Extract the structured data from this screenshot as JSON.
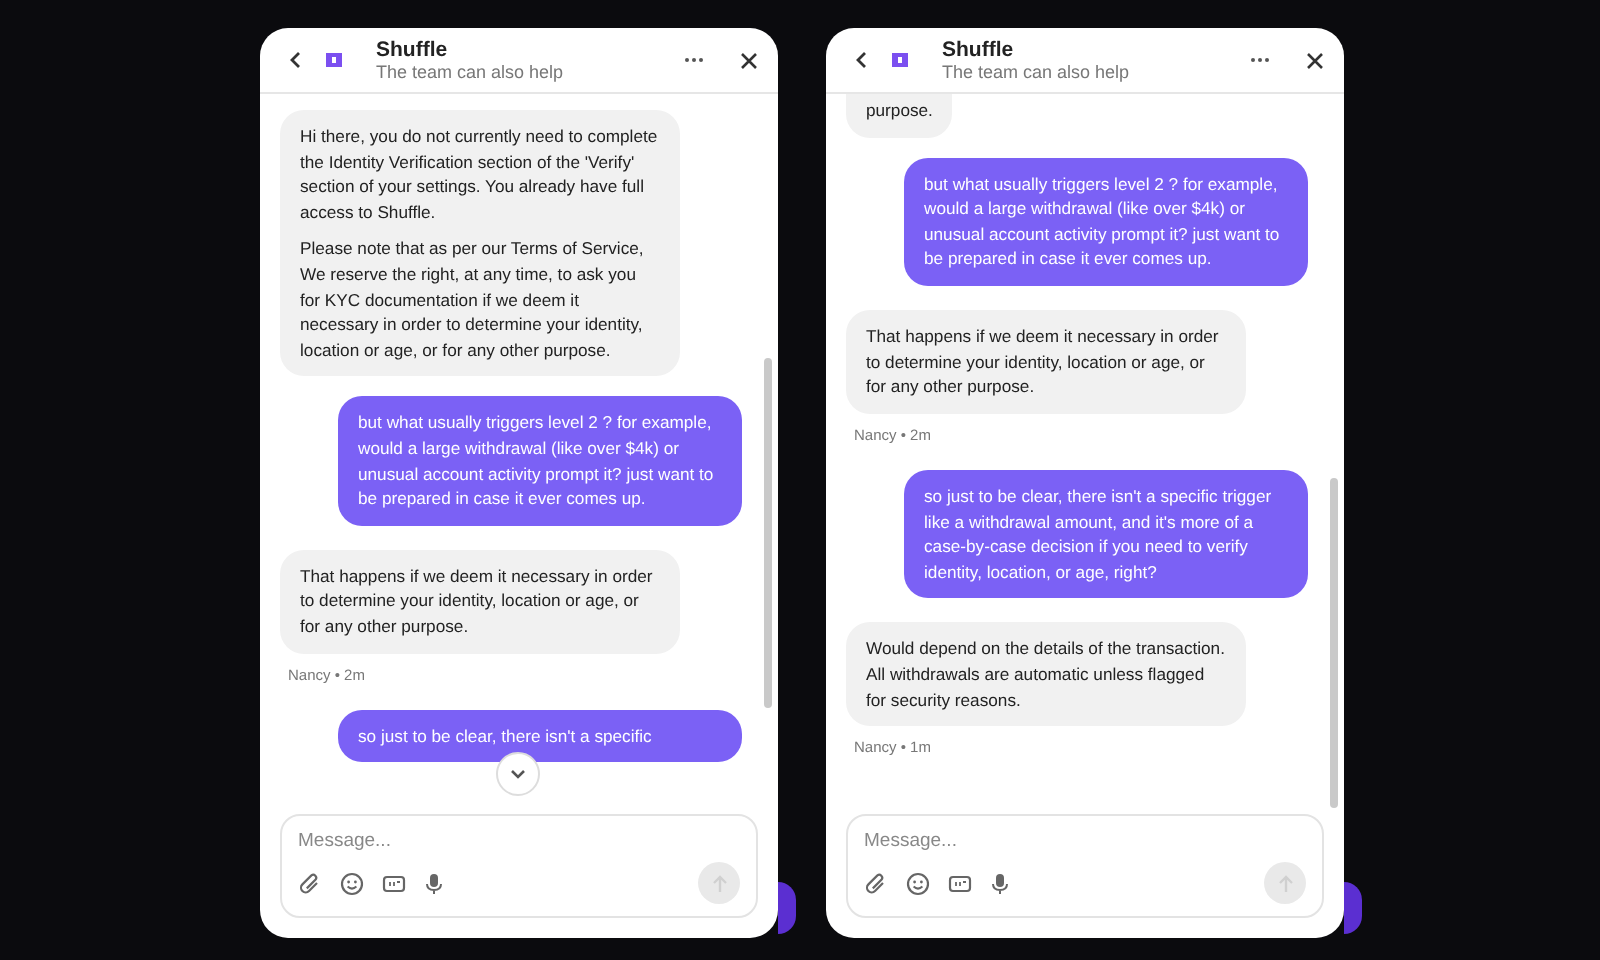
{
  "panels": [
    {
      "header": {
        "title": "Shuffle",
        "subtitle": "The team can also help"
      },
      "messages": [
        {
          "kind": "agent",
          "paragraphs": [
            "Hi there, you do not currently need to complete the Identity Verification section of the 'Verify' section of your settings. You already have full access to Shuffle.",
            "Please note that as per our Terms of Service, We reserve the right, at any time, to ask you for KYC documentation if we deem it necessary in order to determine your identity, location or age, or for any other purpose."
          ]
        },
        {
          "kind": "user",
          "paragraphs": [
            "but what usually triggers level 2 ? for example, would a large withdrawal (like over $4k) or unusual account activity prompt it? just want to be prepared in case it ever comes up."
          ]
        },
        {
          "kind": "agent",
          "paragraphs": [
            "That happens if we deem it necessary in order to determine your identity, location or age, or for any other purpose."
          ],
          "meta": "Nancy • 2m"
        },
        {
          "kind": "user",
          "paragraphs": [
            "so just to be clear, there isn't a specific"
          ]
        }
      ],
      "scroll_down_button": true,
      "composer": {
        "placeholder": "Message...",
        "send_disabled": true
      }
    },
    {
      "header": {
        "title": "Shuffle",
        "subtitle": "The team can also help"
      },
      "messages": [
        {
          "kind": "agent",
          "paragraphs": [
            "purpose."
          ]
        },
        {
          "kind": "user",
          "paragraphs": [
            "but what usually triggers level 2 ? for example, would a large withdrawal (like over $4k) or unusual account activity prompt it? just want to be prepared in case it ever comes up."
          ]
        },
        {
          "kind": "agent",
          "paragraphs": [
            "That happens if we deem it necessary in order to determine your identity, location or age, or for any other purpose."
          ],
          "meta": "Nancy • 2m"
        },
        {
          "kind": "user",
          "paragraphs": [
            "so just to be clear, there isn't a specific trigger like a withdrawal amount, and it's more of a case-by-case decision if you need to verify identity, location, or age, right?"
          ]
        },
        {
          "kind": "agent",
          "paragraphs": [
            "Would depend on the details of the transaction. All withdrawals are automatic unless flagged for security reasons."
          ],
          "meta": "Nancy • 1m"
        }
      ],
      "scroll_down_button": false,
      "composer": {
        "placeholder": "Message...",
        "send_disabled": true
      }
    }
  ]
}
